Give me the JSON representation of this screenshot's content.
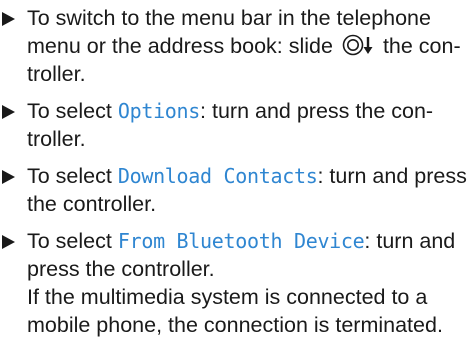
{
  "steps": [
    {
      "pre": "To switch to the menu bar in the telephone menu or the address book: slide",
      "icon": "controller-slide-down-icon",
      "post": "the con-troller."
    },
    {
      "pre": "To select",
      "code": "Options",
      "post": ": turn and press the con-troller."
    },
    {
      "pre": "To select",
      "code": "Download Contacts",
      "post": ": turn and press the controller."
    },
    {
      "pre": "To select",
      "code": "From Bluetooth Device",
      "post": ": turn and press the controller.",
      "note": "If the multimedia system is connected to a mobile phone, the connection is terminated."
    }
  ]
}
